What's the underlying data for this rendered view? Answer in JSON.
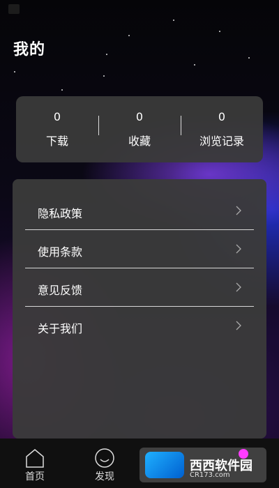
{
  "page": {
    "title": "我的"
  },
  "stats": [
    {
      "count": "0",
      "label": "下载"
    },
    {
      "count": "0",
      "label": "收藏"
    },
    {
      "count": "0",
      "label": "浏览记录"
    }
  ],
  "menu": [
    {
      "label": "隐私政策",
      "icon": "chevron-right-icon"
    },
    {
      "label": "使用条款",
      "icon": "chevron-right-icon"
    },
    {
      "label": "意见反馈",
      "icon": "chevron-right-icon"
    },
    {
      "label": "关于我们",
      "icon": "chevron-right-icon"
    }
  ],
  "tabs": [
    {
      "label": "首页",
      "icon": "home-icon"
    },
    {
      "label": "发现",
      "icon": "smile-icon"
    }
  ],
  "watermark": {
    "brand": "西西软件园",
    "url": "CR173.com"
  },
  "colors": {
    "card": "#3a3a3a",
    "accent_dot": "#ff3cff"
  }
}
